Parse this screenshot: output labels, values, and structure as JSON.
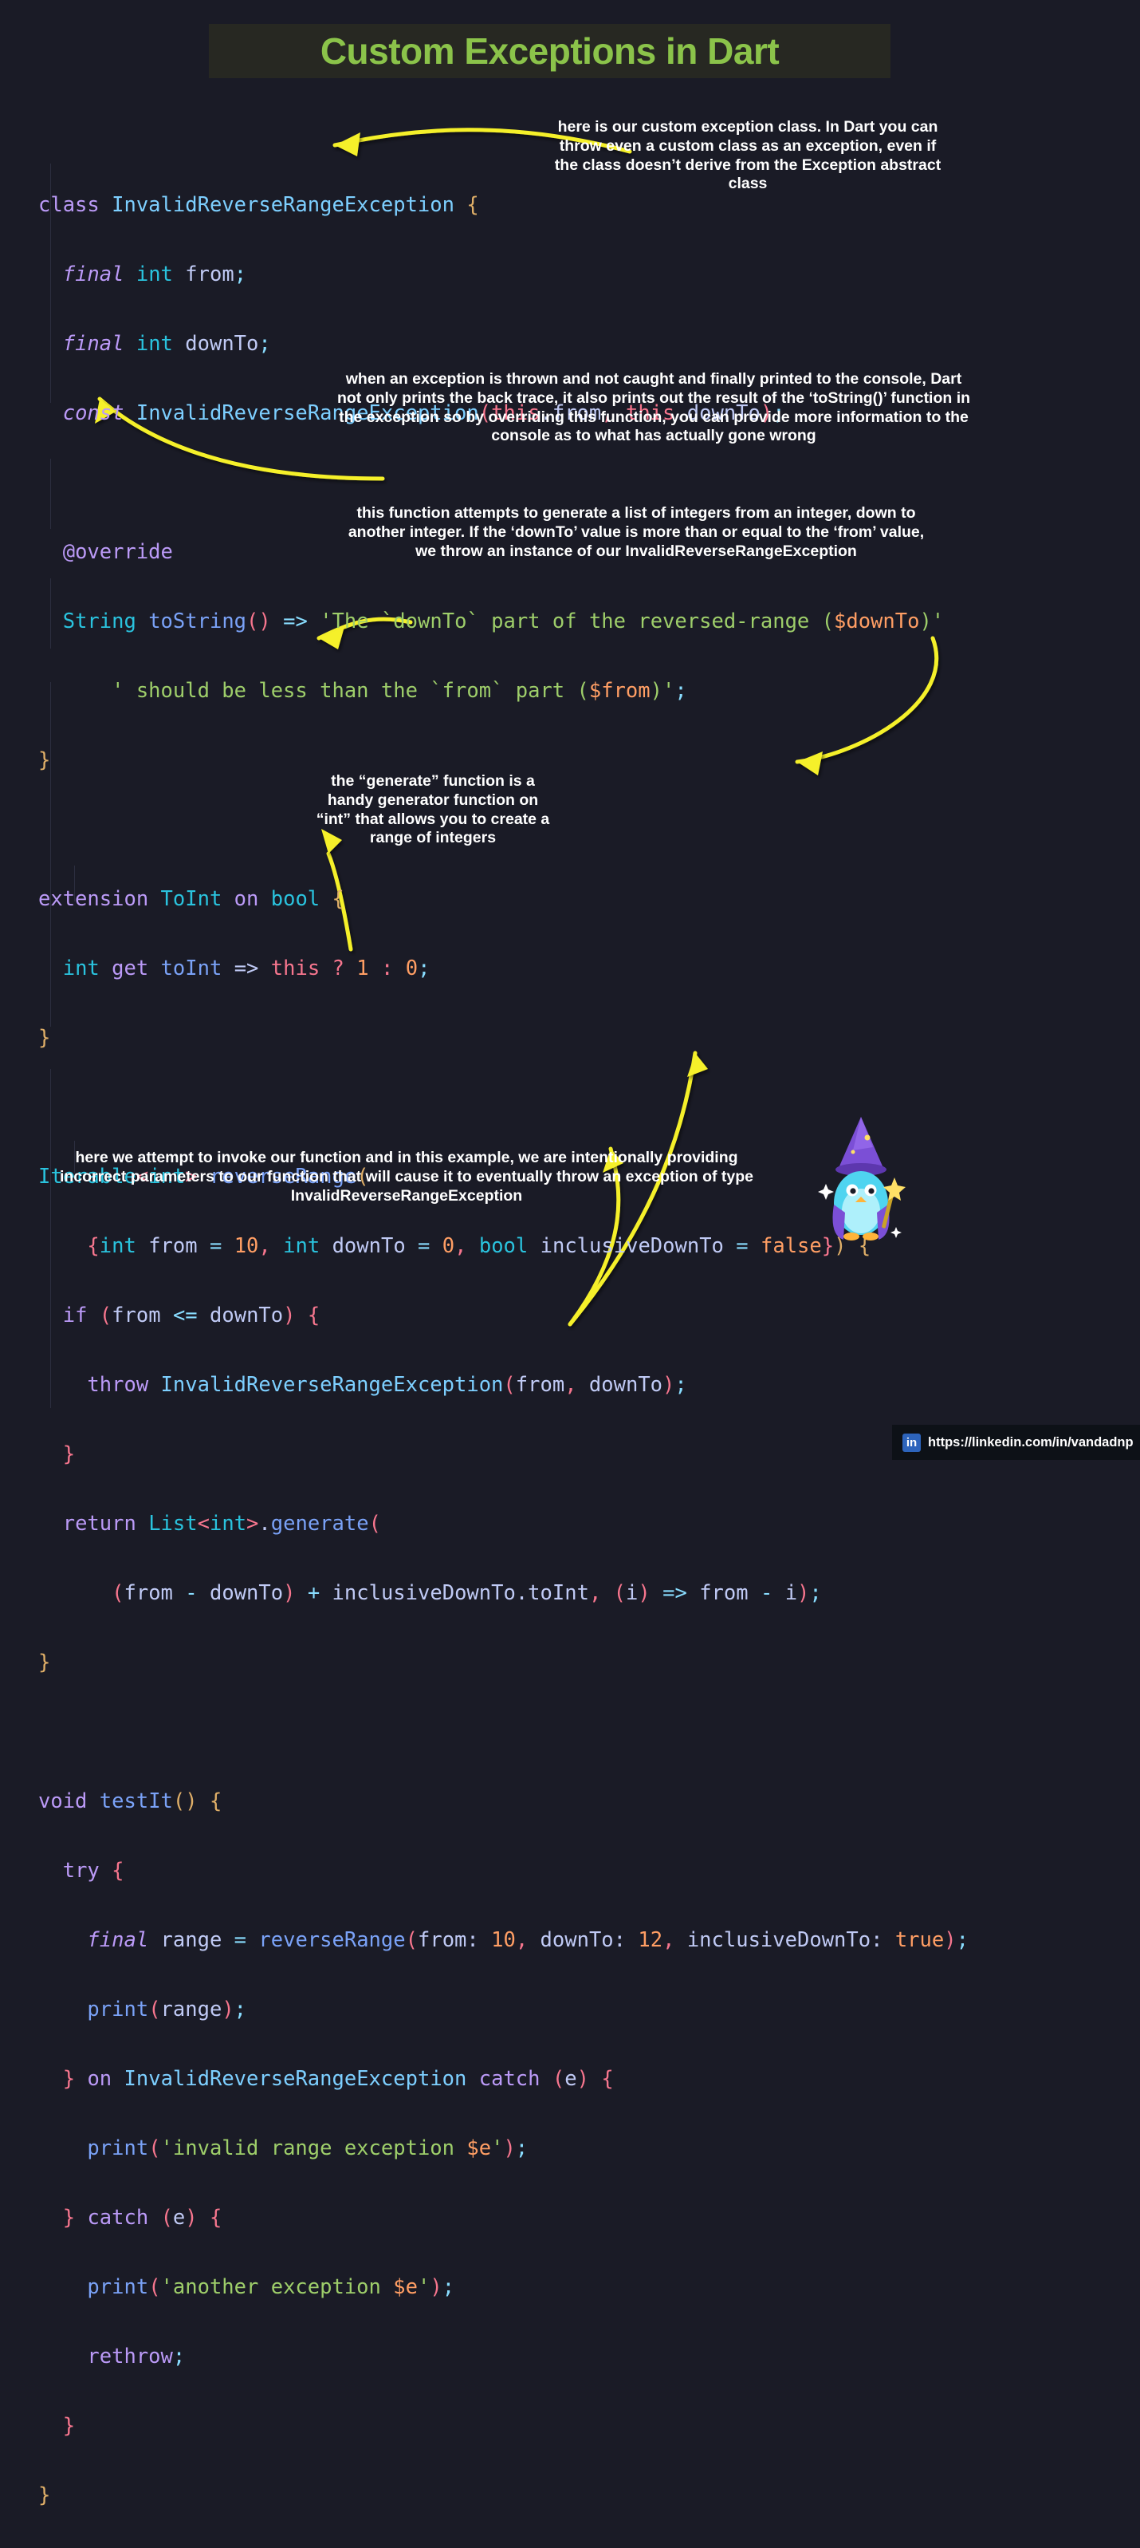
{
  "title": "Custom Exceptions in Dart",
  "theme": {
    "background": "#1a1b26",
    "title_bg": "#272822",
    "title_color": "#8bc34a",
    "arrow_color": "#f5f02a",
    "note_color": "#ffffff",
    "keyword": "#bb9af7",
    "type": "#2ac3de",
    "class": "#7dcfff",
    "function": "#7aa2f7",
    "string": "#9ece6a",
    "number": "#ff9e64",
    "operator": "#89ddff",
    "punct": "#f7768e",
    "brace": "#e0af68",
    "variable": "#c0caf5"
  },
  "code_lines": [
    "class InvalidReverseRangeException {",
    "  final int from;",
    "  final int downTo;",
    "  const InvalidReverseRangeException(this.from, this.downTo);",
    "",
    "  @override",
    "  String toString() => 'The `downTo` part of the reversed-range ($downTo)'",
    "      ' should be less than the `from` part ($from)';",
    "}",
    "",
    "extension ToInt on bool {",
    "  int get toInt => this ? 1 : 0;",
    "}",
    "",
    "Iterable<int> reverseRange(",
    "    {int from = 10, int downTo = 0, bool inclusiveDownTo = false}) {",
    "  if (from <= downTo) {",
    "    throw InvalidReverseRangeException(from, downTo);",
    "  }",
    "  return List<int>.generate(",
    "      (from - downTo) + inclusiveDownTo.toInt, (i) => from - i);",
    "}",
    "",
    "void testIt() {",
    "  try {",
    "    final range = reverseRange(from: 10, downTo: 12, inclusiveDownTo: true);",
    "    print(range);",
    "  } on InvalidReverseRangeException catch (e) {",
    "    print('invalid range exception $e');",
    "  } catch (e) {",
    "    print('another exception $e');",
    "    rethrow;",
    "  }",
    "}"
  ],
  "annotations": [
    {
      "id": "custom-exception-class",
      "text": "here is our custom exception class. In Dart you can throw even a custom class as an exception, even if the class doesn’t derive from the Exception abstract class"
    },
    {
      "id": "tostring-override",
      "text": "when an exception is thrown and not caught and finally printed to the console, Dart not only prints the back trace, it also prints out the result of the ‘toString()’ function in the exception so by overriding this function, you can provide more information to the console as to what has actually gone wrong"
    },
    {
      "id": "reverse-range-function",
      "text": "this function attempts to generate a list of integers from an integer, down to another integer. If the ‘downTo’ value is more than or equal to the ‘from’ value, we throw an instance of our InvalidReverseRangeException"
    },
    {
      "id": "generate-function",
      "text": "the “generate” function is a handy generator function on “int” that allows you to create a range of integers"
    },
    {
      "id": "invoke-function",
      "text": "here we attempt to invoke our function and in this example, we are intentionally providing incorrect parameters to our function that will cause it to eventually throw an exception of type InvalidReverseRangeException"
    }
  ],
  "footer": {
    "icon": "linkedin-icon",
    "icon_text": "in",
    "url": "https://linkedin.com/in/vandadnp"
  }
}
